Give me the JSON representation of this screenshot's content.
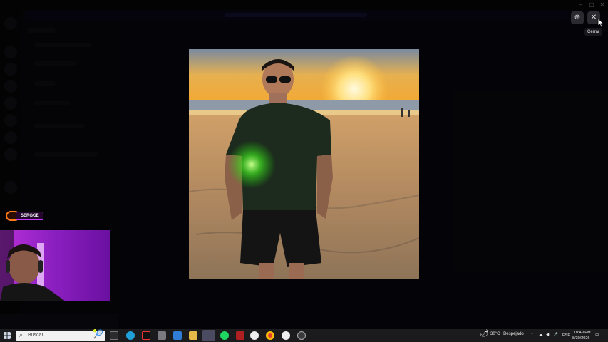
{
  "viewer": {
    "zoom_icon": "zoom-icon",
    "close_icon": "close-icon",
    "close_tooltip": "Cerrar"
  },
  "stream_overlay": {
    "streamer_name": "SERGGE"
  },
  "taskbar": {
    "search_placeholder": "Buscar",
    "weather_temp": "30°C",
    "weather_desc": "Despejado",
    "language": "ESP",
    "time": "10:49 PM",
    "date": "8/30/2026"
  },
  "colors": {
    "accent_purple": "#c33cff",
    "accent_orange": "#ff7a1a"
  }
}
